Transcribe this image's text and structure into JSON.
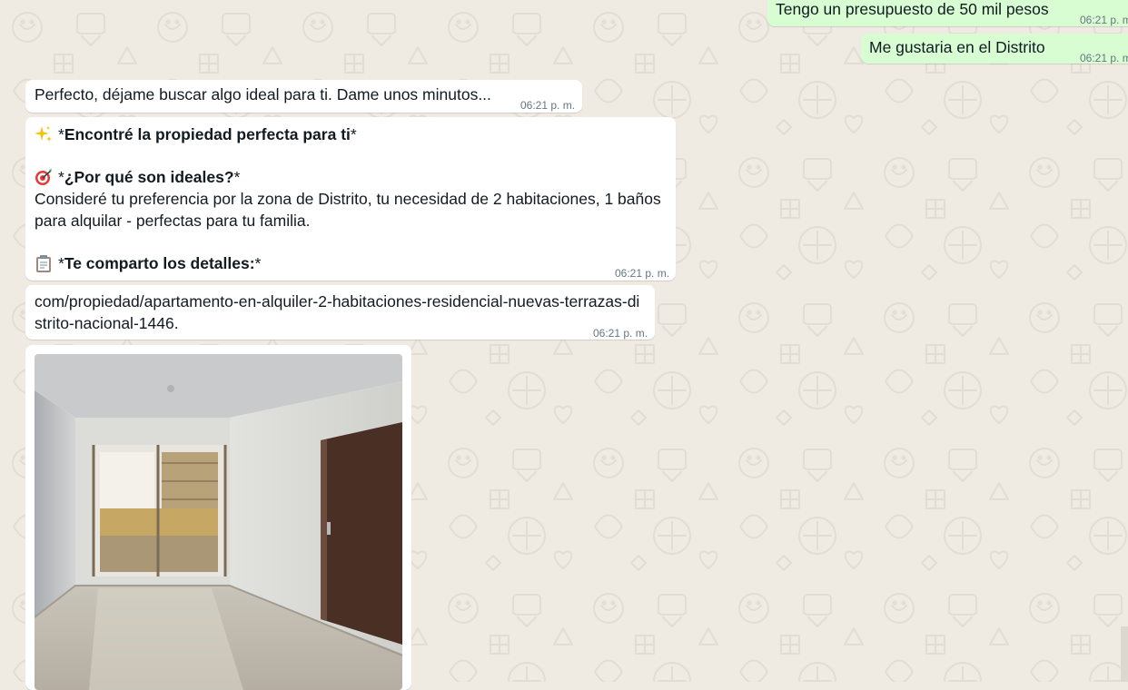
{
  "chat": {
    "messages_out": [
      {
        "text": "Tengo un presupuesto de 50 mil pesos",
        "time": "06:21 p. m."
      },
      {
        "text": "Me gustaria en el Distrito",
        "time": "06:21 p. m."
      }
    ],
    "messages_in": {
      "searching": {
        "text": "Perfecto, déjame buscar algo ideal para ti. Dame unos minutos...",
        "time": "06:21 p. m."
      },
      "property": {
        "line1": "*Encontré la propiedad perfecta para ti*",
        "line1_prefix": "*",
        "line1_bold": "Encontré la propiedad perfecta para ti",
        "line1_suffix": "*",
        "why_prefix": "*",
        "why_bold": "¿Por qué son ideales?",
        "why_suffix": "*",
        "why_body": "Consideré tu preferencia por la zona de Distrito, tu necesidad de 2 habitaciones, 1 baños para alquilar - perfectas para tu familia.",
        "details_prefix": "*",
        "details_bold": "Te comparto los detalles:",
        "details_suffix": "*",
        "time": "06:21 p. m.",
        "emoji_sparkles": "sparkles-icon",
        "emoji_target": "direct-hit-icon",
        "emoji_clipboard": "clipboard-icon"
      },
      "link": {
        "text": "com/propiedad/apartamento-en-alquiler-2-habitaciones-residencial-nuevas-terrazas-distrito-nacional-1446.",
        "time": "06:21 p. m."
      },
      "image": {
        "icon": "apartment-room-photo"
      }
    }
  },
  "colors": {
    "background": "#efeae2",
    "incoming_bubble": "#ffffff",
    "outgoing_bubble": "#d9fdd3",
    "timestamp": "#667781"
  }
}
